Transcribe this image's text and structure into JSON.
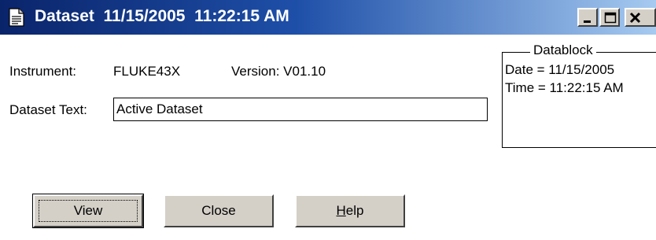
{
  "window": {
    "title": "Dataset  11/15/2005  11:22:15 AM",
    "controls": {
      "minimize": "minimize-icon",
      "maximize": "maximize-icon",
      "close": "close-icon"
    }
  },
  "info": {
    "instrument_label": "Instrument:",
    "instrument_value": "FLUKE43X",
    "version_label": "Version: V01.10"
  },
  "dataset_text": {
    "label": "Dataset Text:",
    "value": "Active Dataset"
  },
  "datablock": {
    "title": "Datablock",
    "date": "Date = 11/15/2005",
    "time": "Time = 11:22:15 AM"
  },
  "buttons": {
    "view": "View",
    "close": "Close",
    "help_mnemonic": "H",
    "help_rest": "elp"
  },
  "colors": {
    "titlebar_start": "#0a246a",
    "titlebar_end": "#a6caf0",
    "button_face": "#d4d0c8"
  }
}
